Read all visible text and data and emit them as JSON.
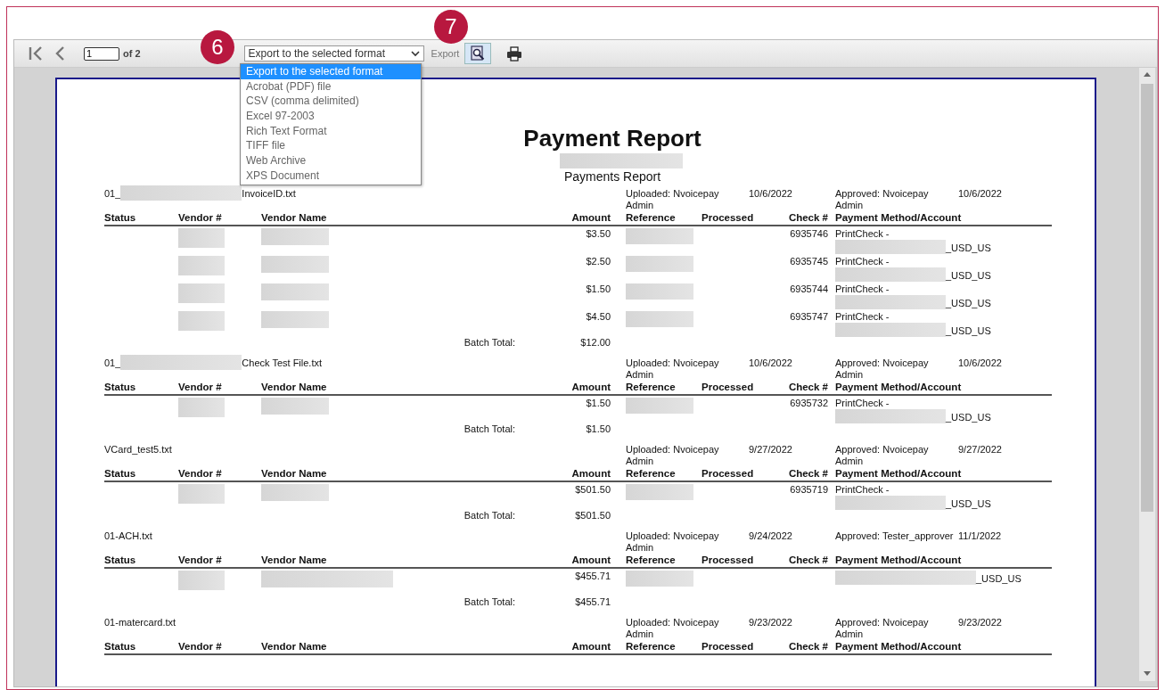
{
  "toolbar": {
    "page_input": "1",
    "page_count": "of 2",
    "export_select": "Export to the selected format",
    "export_button": "Export"
  },
  "export_menu": [
    {
      "label": "Export to the selected format",
      "selected": true
    },
    {
      "label": "Acrobat (PDF) file",
      "selected": false
    },
    {
      "label": "CSV (comma delimited)",
      "selected": false
    },
    {
      "label": "Excel 97-2003",
      "selected": false
    },
    {
      "label": "Rich Text Format",
      "selected": false
    },
    {
      "label": "TIFF file",
      "selected": false
    },
    {
      "label": "Web Archive",
      "selected": false
    },
    {
      "label": "XPS Document",
      "selected": false
    }
  ],
  "callouts": [
    {
      "number": "6"
    },
    {
      "number": "7"
    }
  ],
  "report": {
    "title": "Payment Report",
    "subtitle": "Payments Report",
    "batches": [
      {
        "name_start": "01_",
        "redacted": true,
        "name_end": "InvoiceID.txt",
        "uploaded": "Uploaded: Nvoicepay Admin",
        "uploaded_date": "10/6/2022",
        "approved": "Approved: Nvoicepay Admin",
        "approved_date": "10/6/2022",
        "columns": [
          "Status",
          "Vendor #",
          "Vendor Name",
          "Amount",
          "Reference",
          "Processed",
          "Check #",
          "Payment Method/Account"
        ],
        "rows": [
          {
            "amount": "$3.50",
            "check": "6935746",
            "method": "PrintCheck -",
            "account_suffix": "_USD_US",
            "wide": false
          },
          {
            "amount": "$2.50",
            "check": "6935745",
            "method": "PrintCheck -",
            "account_suffix": "_USD_US",
            "wide": false
          },
          {
            "amount": "$1.50",
            "check": "6935744",
            "method": "PrintCheck -",
            "account_suffix": "_USD_US",
            "wide": false
          },
          {
            "amount": "$4.50",
            "check": "6935747",
            "method": "PrintCheck -",
            "account_suffix": "_USD_US",
            "wide": false
          }
        ],
        "total_label": "Batch Total:",
        "total": "$12.00"
      },
      {
        "name_start": "01_",
        "redacted": true,
        "name_end": "Check Test File.txt",
        "uploaded": "Uploaded: Nvoicepay Admin",
        "uploaded_date": "10/6/2022",
        "approved": "Approved: Nvoicepay Admin",
        "approved_date": "10/6/2022",
        "columns": [
          "Status",
          "Vendor #",
          "Vendor Name",
          "Amount",
          "Reference",
          "Processed",
          "Check #",
          "Payment Method/Account"
        ],
        "rows": [
          {
            "amount": "$1.50",
            "check": "6935732",
            "method": "PrintCheck -",
            "account_suffix": "_USD_US",
            "wide": false
          }
        ],
        "total_label": "Batch Total:",
        "total": "$1.50"
      },
      {
        "name_start": "VCard_test5.txt",
        "redacted": false,
        "uploaded": "Uploaded: Nvoicepay Admin",
        "uploaded_date": "9/27/2022",
        "approved": "Approved: Nvoicepay Admin",
        "approved_date": "9/27/2022",
        "columns": [
          "Status",
          "Vendor #",
          "Vendor Name",
          "Amount",
          "Reference",
          "Processed",
          "Check #",
          "Payment Method/Account"
        ],
        "rows": [
          {
            "amount": "$501.50",
            "check": "6935719",
            "method": "PrintCheck -",
            "account_suffix": "_USD_US",
            "wide": false
          }
        ],
        "total_label": "Batch Total:",
        "total": "$501.50"
      },
      {
        "name_start": "01-ACH.txt",
        "redacted": false,
        "uploaded": "Uploaded: Nvoicepay Admin",
        "uploaded_date": "9/24/2022",
        "approved": "Approved: Tester_approver",
        "approved_date": "11/1/2022",
        "columns": [
          "Status",
          "Vendor #",
          "Vendor Name",
          "Amount",
          "Reference",
          "Processed",
          "Check #",
          "Payment Method/Account"
        ],
        "rows": [
          {
            "amount": "$455.71",
            "account_suffix": "_USD_US",
            "wide": true
          }
        ],
        "total_label": "Batch Total:",
        "total": "$455.71"
      },
      {
        "name_start": "01-matercard.txt",
        "redacted": false,
        "uploaded": "Uploaded: Nvoicepay Admin",
        "uploaded_date": "9/23/2022",
        "approved": "Approved: Nvoicepay Admin",
        "approved_date": "9/23/2022",
        "columns": [
          "Status",
          "Vendor #",
          "Vendor Name",
          "Amount",
          "Reference",
          "Processed",
          "Check #",
          "Payment Method/Account"
        ]
      }
    ]
  }
}
